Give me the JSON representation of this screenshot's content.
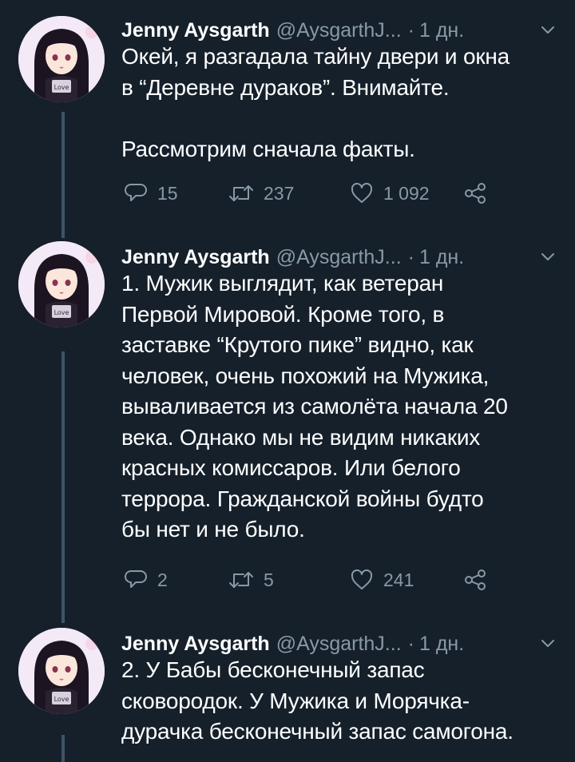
{
  "colors": {
    "background": "#15202b",
    "text_primary": "#ffffff",
    "text_secondary": "#8899a6",
    "thread_line": "#3d5466"
  },
  "tweets": [
    {
      "author_name": "Jenny Aysgarth",
      "handle": "@AysgarthJ...",
      "separator": "·",
      "time": "1 дн.",
      "avatar_icon": "anime-girl-avatar-icon",
      "text": "Окей, я разгадала тайну двери и окна\nв “Деревне дураков”. Внимайте.\n\nРассмотрим сначала факты.",
      "replies": "15",
      "retweets": "237",
      "likes": "1 092"
    },
    {
      "author_name": "Jenny Aysgarth",
      "handle": "@AysgarthJ...",
      "separator": "·",
      "time": "1 дн.",
      "avatar_icon": "anime-girl-avatar-icon",
      "text": "1. Мужик выглядит, как ветеран\nПервой Мировой. Кроме того, в\nзаставке “Крутого пике” видно, как\nчеловек, очень похожий на Мужика,\nвываливается из самолёта начала 20\nвека. Однако мы не видим никаких\nкрасных комиссаров. Или белого\nтеррора. Гражданской войны будто\nбы нет и не было.",
      "replies": "2",
      "retweets": "5",
      "likes": "241"
    },
    {
      "author_name": "Jenny Aysgarth",
      "handle": "@AysgarthJ...",
      "separator": "·",
      "time": "1 дн.",
      "avatar_icon": "anime-girl-avatar-icon",
      "text": "2. У Бабы бесконечный запас\nсковородок. У Мужика и Морячка-\nдурачка бесконечный запас самогона."
    }
  ]
}
